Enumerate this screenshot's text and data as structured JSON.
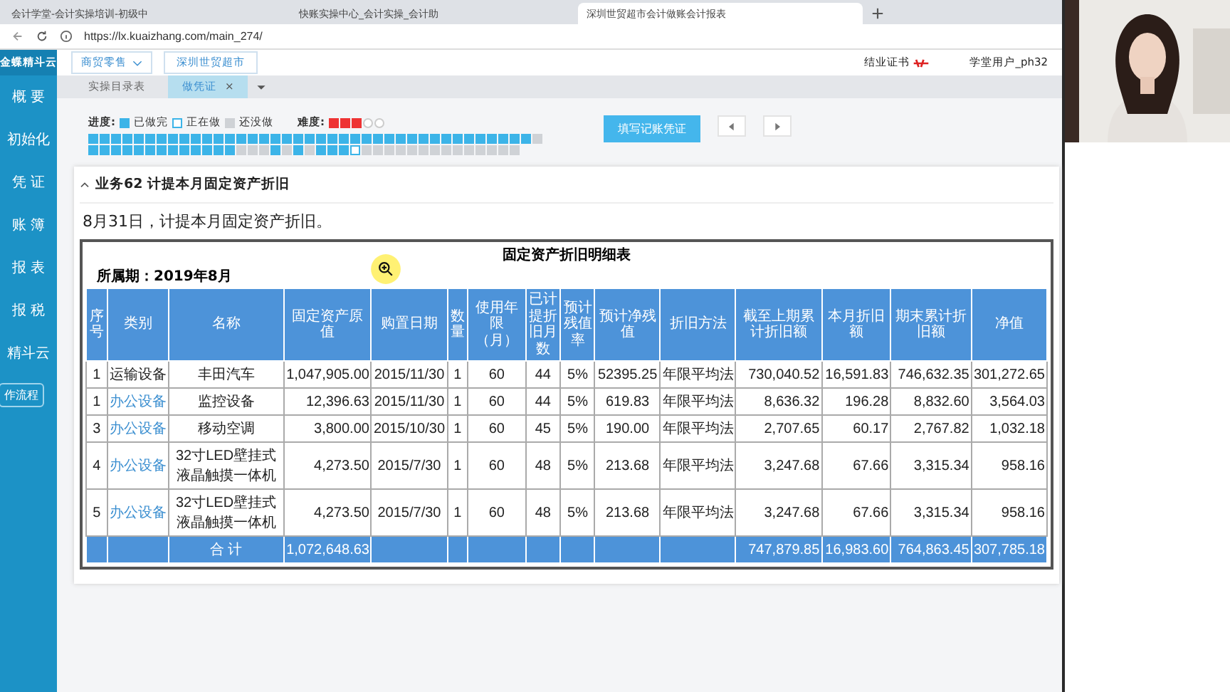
{
  "browser": {
    "tabs": [
      {
        "label": "会计学堂-会计实操培训-初级中",
        "selected": false
      },
      {
        "label": "快账实操中心_会计实操_会计助",
        "selected": false
      },
      {
        "label": "深圳世贸超市会计做账会计报表",
        "selected": true
      }
    ],
    "url": "https://lx.kuaizhang.com/main_274/"
  },
  "sidebar": {
    "logo": "金蝶精斗云",
    "items": [
      "概 要",
      "初始化",
      "凭 证",
      "账 簿",
      "报 表",
      "报 税",
      "精斗云"
    ],
    "flow_button": "作流程"
  },
  "header": {
    "industry": "商贸零售",
    "company": "深圳世贸超市",
    "certificate": "结业证书",
    "user": "学堂用户_ph32"
  },
  "tabs": [
    {
      "label": "实操目录表",
      "selected": false
    },
    {
      "label": "做凭证",
      "selected": true,
      "close": "×"
    }
  ],
  "progress": {
    "label": "进度:",
    "legend": [
      {
        "kind": "done",
        "label": "已做完"
      },
      {
        "kind": "doing",
        "label": "正在做"
      },
      {
        "kind": "todo",
        "label": "还没做"
      }
    ],
    "difficulty_label": "难度:",
    "stars": 3,
    "steps": [
      {
        "kind": "done"
      },
      {
        "kind": "done"
      },
      {
        "kind": "done"
      },
      {
        "kind": "done"
      },
      {
        "kind": "done"
      },
      {
        "kind": "done"
      },
      {
        "kind": "done"
      },
      {
        "kind": "done"
      },
      {
        "kind": "done"
      },
      {
        "kind": "done"
      },
      {
        "kind": "done"
      },
      {
        "kind": "done"
      },
      {
        "kind": "done"
      },
      {
        "kind": "done"
      },
      {
        "kind": "done"
      },
      {
        "kind": "done"
      },
      {
        "kind": "done"
      },
      {
        "kind": "done"
      },
      {
        "kind": "done"
      },
      {
        "kind": "done"
      },
      {
        "kind": "done"
      },
      {
        "kind": "done"
      },
      {
        "kind": "done"
      },
      {
        "kind": "done"
      },
      {
        "kind": "done"
      },
      {
        "kind": "done"
      },
      {
        "kind": "done"
      },
      {
        "kind": "done"
      },
      {
        "kind": "done"
      },
      {
        "kind": "done"
      },
      {
        "kind": "done"
      },
      {
        "kind": "done"
      },
      {
        "kind": "done"
      },
      {
        "kind": "done"
      },
      {
        "kind": "done"
      },
      {
        "kind": "done"
      },
      {
        "kind": "done"
      },
      {
        "kind": "done"
      },
      {
        "kind": "done"
      },
      {
        "kind": "todo"
      },
      {
        "kind": "done"
      },
      {
        "kind": "done"
      },
      {
        "kind": "done"
      },
      {
        "kind": "done"
      },
      {
        "kind": "done"
      },
      {
        "kind": "done"
      },
      {
        "kind": "done"
      },
      {
        "kind": "done"
      },
      {
        "kind": "done"
      },
      {
        "kind": "done"
      },
      {
        "kind": "done"
      },
      {
        "kind": "done"
      },
      {
        "kind": "done"
      },
      {
        "kind": "todo"
      },
      {
        "kind": "todo"
      },
      {
        "kind": "todo"
      },
      {
        "kind": "done"
      },
      {
        "kind": "todo"
      },
      {
        "kind": "done"
      },
      {
        "kind": "todo"
      },
      {
        "kind": "done"
      },
      {
        "kind": "done"
      },
      {
        "kind": "done"
      },
      {
        "kind": "doing"
      },
      {
        "kind": "todo"
      },
      {
        "kind": "todo"
      },
      {
        "kind": "todo"
      },
      {
        "kind": "todo"
      },
      {
        "kind": "todo"
      },
      {
        "kind": "todo"
      },
      {
        "kind": "todo"
      },
      {
        "kind": "todo"
      },
      {
        "kind": "todo"
      },
      {
        "kind": "todo"
      },
      {
        "kind": "todo"
      },
      {
        "kind": "todo"
      },
      {
        "kind": "todo"
      },
      {
        "kind": "todo"
      }
    ]
  },
  "actions": {
    "fill_voucher": "填写记账凭证"
  },
  "task": {
    "title": "业务62 计提本月固定资产折旧",
    "expanded": true,
    "description": "8月31日，计提本月固定资产折旧。",
    "sheet": {
      "title": "固定资产折旧明细表",
      "period": "所属期：2019年8月",
      "columns": [
        "序号",
        "类别",
        "名称",
        "固定资产原值",
        "购置日期",
        "数量",
        "使用年限（月）",
        "已计提折旧月数",
        "预计残值率",
        "预计净残值",
        "折旧方法",
        "截至上期累计折旧额",
        "本月折旧额",
        "期末累计折旧额",
        "净值"
      ],
      "rows": [
        [
          "1",
          "运输设备",
          "丰田汽车",
          "1,047,905.00",
          "2015/11/30",
          "1",
          "60",
          "44",
          "5%",
          "52395.25",
          "年限平均法",
          "730,040.52",
          "16,591.83",
          "746,632.35",
          "301,272.65"
        ],
        [
          "1",
          "办公设备",
          "监控设备",
          "12,396.63",
          "2015/11/30",
          "1",
          "60",
          "44",
          "5%",
          "619.83",
          "年限平均法",
          "8,636.32",
          "196.28",
          "8,832.60",
          "3,564.03"
        ],
        [
          "3",
          "办公设备",
          "移动空调",
          "3,800.00",
          "2015/10/30",
          "1",
          "60",
          "45",
          "5%",
          "190.00",
          "年限平均法",
          "2,707.65",
          "60.17",
          "2,767.82",
          "1,032.18"
        ],
        [
          "4",
          "办公设备",
          "32寸LED壁挂式液晶触摸一体机",
          "4,273.50",
          "2015/7/30",
          "1",
          "60",
          "48",
          "5%",
          "213.68",
          "年限平均法",
          "3,247.68",
          "67.66",
          "3,315.34",
          "958.16"
        ],
        [
          "5",
          "办公设备",
          "32寸LED壁挂式液晶触摸一体机",
          "4,273.50",
          "2015/7/30",
          "1",
          "60",
          "48",
          "5%",
          "213.68",
          "年限平均法",
          "3,247.68",
          "67.66",
          "3,315.34",
          "958.16"
        ]
      ],
      "total": [
        "合 计",
        "1,072,648.63",
        "747,879.85",
        "16,983.60",
        "764,863.45",
        "307,785.18"
      ]
    }
  }
}
